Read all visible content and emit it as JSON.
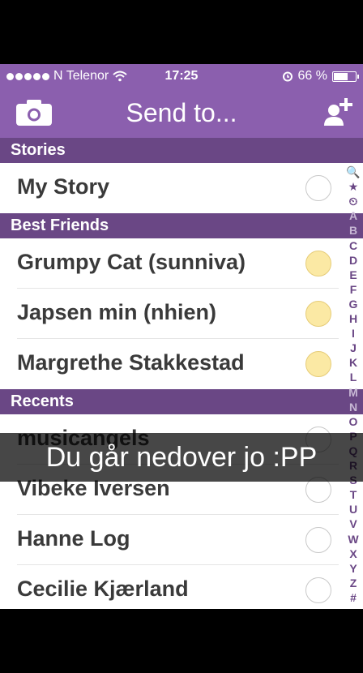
{
  "status_bar": {
    "carrier": "N Telenor",
    "time": "17:25",
    "battery": "66 %",
    "battery_level": 0.66
  },
  "nav": {
    "title": "Send to...",
    "camera_icon": "camera-icon",
    "add_friend_icon": "add-friend-icon"
  },
  "sections": {
    "stories": {
      "header": "Stories",
      "rows": [
        {
          "label": "My Story",
          "selected": false
        }
      ]
    },
    "best_friends": {
      "header": "Best Friends",
      "rows": [
        {
          "label": "Grumpy Cat (sunniva)"
        },
        {
          "label": "Japsen min (nhien)"
        },
        {
          "label": "Margrethe Stakkestad"
        }
      ]
    },
    "recents": {
      "header": "Recents",
      "rows": [
        {
          "label": "musicangels"
        },
        {
          "label": "Vibeke Iversen"
        },
        {
          "label": "Hanne Log"
        },
        {
          "label": "Cecilie Kjærland"
        }
      ]
    }
  },
  "index": [
    "🔍",
    "★",
    "⏲",
    "A",
    "B",
    "C",
    "D",
    "E",
    "F",
    "G",
    "H",
    "I",
    "J",
    "K",
    "L",
    "M",
    "N",
    "O",
    "P",
    "Q",
    "R",
    "S",
    "T",
    "U",
    "V",
    "W",
    "X",
    "Y",
    "Z",
    "#"
  ],
  "caption": "Du går nedover jo :PP",
  "colors": {
    "nav_purple": "#8b5fae",
    "section_purple": "#6a4785",
    "best_friend_radio": "#fbe9a4"
  }
}
